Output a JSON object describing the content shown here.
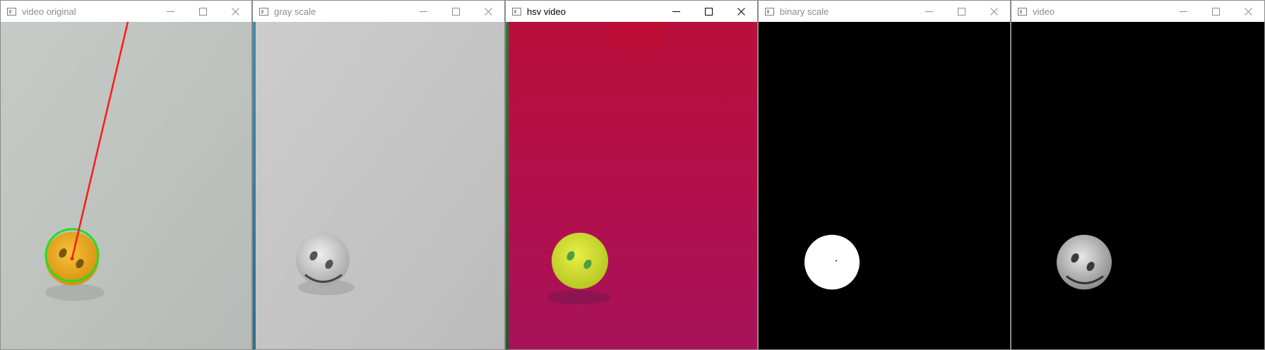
{
  "windows": [
    {
      "title": "video original",
      "active": false
    },
    {
      "title": "gray scale",
      "active": false
    },
    {
      "title": "hsv video",
      "active": true
    },
    {
      "title": "binary scale",
      "active": false
    },
    {
      "title": "video",
      "active": false
    }
  ],
  "icons": {
    "app": "window-app-icon",
    "minimize": "minimize-icon",
    "maximize": "maximize-icon",
    "close": "close-icon"
  },
  "colors": {
    "original_bg": "#bfc4c0",
    "ball_yellow": "#f2b21c",
    "detection_circle": "#22dd22",
    "tracking_line": "#ff1a1a",
    "gray_bg": "#c8c8c8",
    "hsv_bg": "#b5104a",
    "hsv_ball": "#d9e23a",
    "binary_bg": "#000000",
    "binary_blob": "#ffffff"
  }
}
